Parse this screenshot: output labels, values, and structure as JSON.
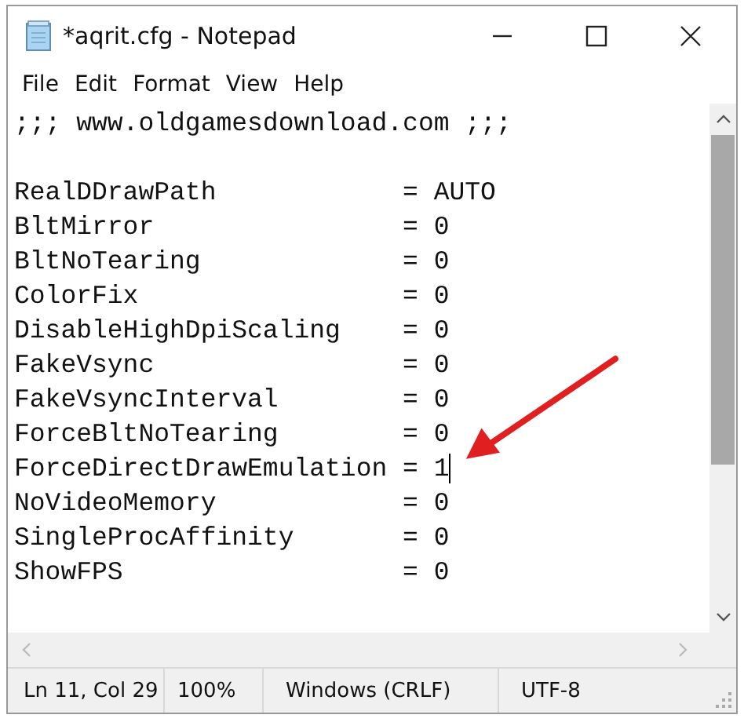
{
  "window": {
    "title": "*aqrit.cfg - Notepad"
  },
  "menu": [
    "File",
    "Edit",
    "Format",
    "View",
    "Help"
  ],
  "editor": {
    "header": ";;; www.oldgamesdownload.com ;;;",
    "settings": [
      {
        "text": "RealDDrawPath            = AUTO",
        "caret": false
      },
      {
        "text": "BltMirror                = 0",
        "caret": false
      },
      {
        "text": "BltNoTearing             = 0",
        "caret": false
      },
      {
        "text": "ColorFix                 = 0",
        "caret": false
      },
      {
        "text": "DisableHighDpiScaling    = 0",
        "caret": false
      },
      {
        "text": "FakeVsync                = 0",
        "caret": false
      },
      {
        "text": "FakeVsyncInterval        = 0",
        "caret": false
      },
      {
        "text": "ForceBltNoTearing        = 0",
        "caret": false
      },
      {
        "text": "ForceDirectDrawEmulation = 1",
        "caret": true
      },
      {
        "text": "NoVideoMemory            = 0",
        "caret": false
      },
      {
        "text": "SingleProcAffinity       = 0",
        "caret": false
      },
      {
        "text": "ShowFPS                  = 0",
        "caret": false
      }
    ]
  },
  "status_bar": [
    "Ln 11, Col 29",
    "100%",
    "Windows (CRLF)",
    "UTF-8"
  ]
}
